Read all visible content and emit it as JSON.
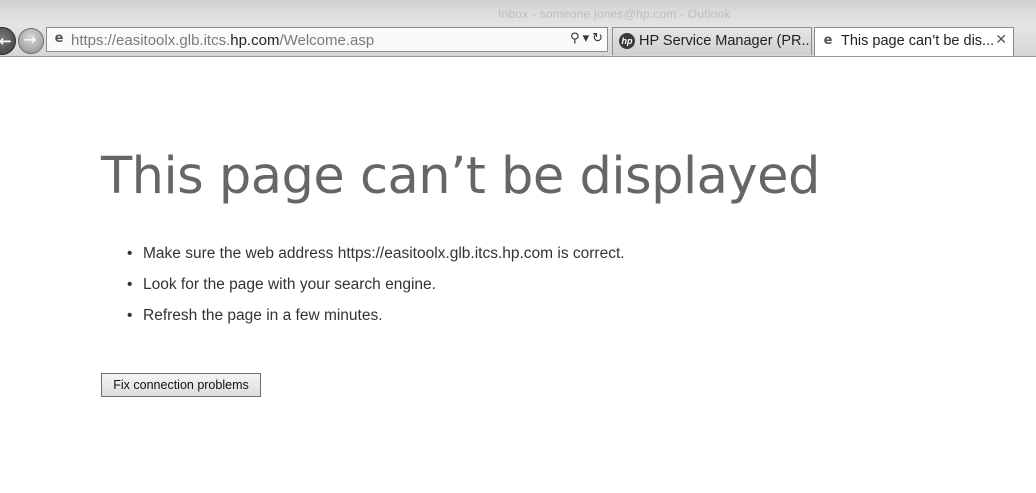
{
  "window": {
    "background_title": "Inbox - someone.jones@hp.com - Outlook"
  },
  "address_bar": {
    "url_prefix": "https://easitoolx.glb.itcs.",
    "url_domain": "hp.com",
    "url_suffix": "/Welcome.asp",
    "search_glyph": "⚲",
    "dropdown_glyph": "▾",
    "refresh_glyph": "↻"
  },
  "tabs": [
    {
      "label": "HP Service Manager (PR...",
      "icon": "hp-logo-icon",
      "active": false
    },
    {
      "label": "This page can’t be dis...",
      "icon": "ie-page-icon",
      "active": true,
      "close": "✕"
    }
  ],
  "error_page": {
    "title": "This page can’t be displayed",
    "bullets": [
      "Make sure the web address https://easitoolx.glb.itcs.hp.com is correct.",
      "Look for the page with your search engine.",
      "Refresh the page in a few minutes."
    ],
    "button_label": "Fix connection problems"
  }
}
